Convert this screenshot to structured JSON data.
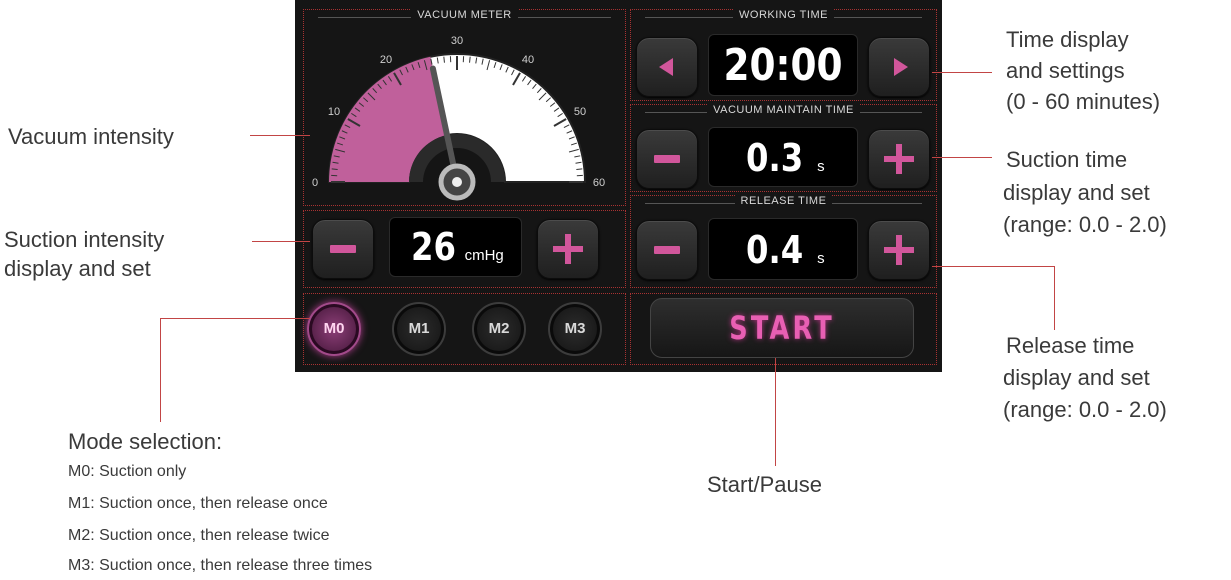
{
  "device": {
    "vacuum_meter_title": "VACUUM METER",
    "gauge": {
      "ticks": [
        "0",
        "10",
        "20",
        "30",
        "40",
        "50",
        "60"
      ],
      "min": 0,
      "max": 60,
      "value": 26,
      "fill_color": "#c0609b"
    },
    "suction": {
      "value": "26",
      "unit": "cmHg"
    },
    "working_time": {
      "title": "WORKING TIME",
      "value": "20:00"
    },
    "vacuum_maintain_time": {
      "title": "VACUUM MAINTAIN TIME",
      "value": "0.3",
      "unit": "s"
    },
    "release_time": {
      "title": "RELEASE TIME",
      "value": "0.4",
      "unit": "s"
    },
    "modes": [
      {
        "label": "M0",
        "active": true
      },
      {
        "label": "M1",
        "active": false
      },
      {
        "label": "M2",
        "active": false
      },
      {
        "label": "M3",
        "active": false
      }
    ],
    "start_label": "START",
    "accent_color": "#d1569b"
  },
  "callouts": {
    "vacuum_intensity": "Vacuum intensity",
    "suction_intensity": [
      "Suction intensity",
      "display and set"
    ],
    "time_display": [
      "Time display",
      "and settings",
      "(0 - 60 minutes)"
    ],
    "suction_time": [
      "Suction time",
      "display and set",
      "(range: 0.0 - 2.0)"
    ],
    "release_time": [
      "Release time",
      "display and set",
      "(range: 0.0 - 2.0)"
    ],
    "mode_selection": {
      "title": "Mode selection:",
      "lines": [
        "M0: Suction only",
        "M1: Suction once, then release once",
        "M2: Suction once, then release twice",
        "M3: Suction once, then release three times"
      ]
    },
    "start_pause": "Start/Pause"
  }
}
